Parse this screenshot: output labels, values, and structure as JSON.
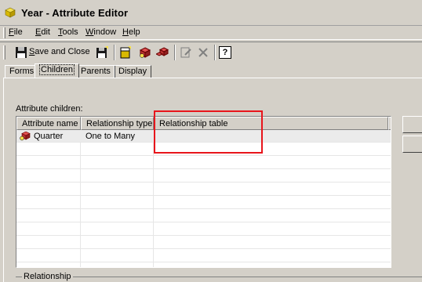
{
  "window": {
    "title": "Year - Attribute Editor"
  },
  "menu": [
    {
      "key": "F",
      "rest": "ile"
    },
    {
      "key": "E",
      "rest": "dit"
    },
    {
      "key": "T",
      "rest": "ools"
    },
    {
      "key": "W",
      "rest": "indow"
    },
    {
      "key": "H",
      "rest": "elp"
    }
  ],
  "toolbar": {
    "save_close_prefix": "",
    "save_close_key": "S",
    "save_close_rest": "ave and Close",
    "help_label": "?"
  },
  "tabs": [
    "Forms",
    "Children",
    "Parents",
    "Display"
  ],
  "active_tab": "Children",
  "children_section": {
    "label": "Attribute children:"
  },
  "grid": {
    "columns": [
      "Attribute name",
      "Relationship type",
      "Relationship table"
    ],
    "rows": [
      {
        "name": "Quarter",
        "type": "One to Many",
        "table": ""
      }
    ]
  },
  "relationship_group": {
    "label": "Relationship"
  },
  "colors": {
    "highlight": "#e8151b",
    "face": "#d4d0c8"
  }
}
